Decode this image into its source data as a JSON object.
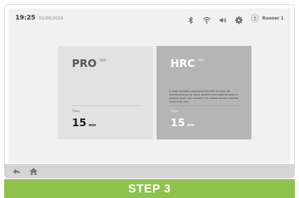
{
  "status_bar": {
    "time": "19:25",
    "date": "02/06/2019",
    "icons": [
      "bluetooth-icon",
      "wifi-icon",
      "volume-icon",
      "settings-gear-icon"
    ],
    "user_label": "Runner 1"
  },
  "cards": {
    "pro": {
      "title": "PRO",
      "badge": "TEST",
      "time_label": "Time",
      "time_value": "15",
      "time_unit": "min"
    },
    "hrc": {
      "title": "HRC",
      "badge": "TEST",
      "description": "In order to better experience the HRC function we recommend you to check whether the treadmill equip a wireless heart rate receiver. If so please equip a wireless chest strap also.",
      "time_label": "Time",
      "time_value": "15",
      "time_unit": "min"
    }
  },
  "nav": {
    "icons": [
      "back-arrow-icon",
      "home-icon"
    ]
  },
  "banner": {
    "label": "STEP 3"
  },
  "colors": {
    "banner_green": "#8fc24a",
    "pro_card": "#e2e2e2",
    "hrc_card": "#b5b5b5",
    "navbar": "#d5d5d5"
  }
}
